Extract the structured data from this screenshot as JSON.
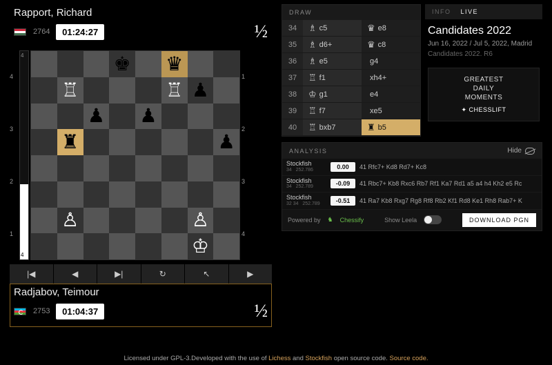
{
  "topPlayer": {
    "name": "Rapport, Richard",
    "rating": "2764",
    "clock": "01:24:27",
    "score": "½",
    "flag": "hun"
  },
  "bottomPlayer": {
    "name": "Radjabov, Teimour",
    "rating": "2753",
    "clock": "01:04:37",
    "score": "½",
    "flag": "aze"
  },
  "board": {
    "ranks_left": [
      "4",
      "3",
      "2",
      "1"
    ],
    "ranks_right": [
      "1",
      "2",
      "3",
      "4"
    ],
    "eval_top": "4",
    "eval_bottom": "4",
    "eval_white_pct": 36,
    "position": [
      [
        "",
        "",
        "",
        "bk",
        "",
        "bq",
        "",
        ""
      ],
      [
        "",
        "wr",
        "",
        "",
        "",
        "wr",
        "bp",
        ""
      ],
      [
        "",
        "",
        "bp",
        "",
        "bp",
        "",
        "",
        ""
      ],
      [
        "",
        "br",
        "",
        "",
        "",
        "",
        "",
        "bp"
      ],
      [
        "",
        "",
        "",
        "",
        "",
        "",
        "",
        ""
      ],
      [
        "",
        "",
        "",
        "",
        "",
        "",
        "",
        ""
      ],
      [
        "",
        "wp",
        "",
        "",
        "",
        "",
        "wp",
        ""
      ],
      [
        "",
        "",
        "",
        "",
        "",
        "",
        "wk",
        ""
      ]
    ],
    "hl": [
      [
        0,
        5
      ],
      [
        3,
        1
      ]
    ]
  },
  "controls": {
    "first": "|◀",
    "prev": "◀",
    "next": "▶|",
    "refresh": "↻",
    "cursor": "↖",
    "play": "▶"
  },
  "drawLabel": "DRAW",
  "tabs": {
    "info": "INFO",
    "live": "LIVE"
  },
  "event": {
    "title": "Candidates 2022",
    "dates": "Jun 16, 2022 / Jul 5, 2022, Madrid",
    "round": "Candidates 2022. R6"
  },
  "promo": {
    "line1": "GREATEST",
    "line2": "DAILY",
    "line3": "MOMENTS",
    "brand": "✦ CHESSLIFT"
  },
  "moves": [
    {
      "n": "34",
      "wp": "♗",
      "w": "c5",
      "bp": "♛",
      "b": "e8"
    },
    {
      "n": "35",
      "wp": "♗",
      "w": "d6+",
      "bp": "♛",
      "b": "c8"
    },
    {
      "n": "36",
      "wp": "♗",
      "w": "e5",
      "bp": "",
      "b": "g4"
    },
    {
      "n": "37",
      "wp": "♖",
      "w": "f1",
      "bp": "",
      "b": "xh4+"
    },
    {
      "n": "38",
      "wp": "♔",
      "w": "g1",
      "bp": "",
      "b": "e4"
    },
    {
      "n": "39",
      "wp": "♖",
      "w": "f7",
      "bp": "",
      "b": "xe5"
    },
    {
      "n": "40",
      "wp": "♖",
      "w": "bxb7",
      "bp": "♜",
      "b": "b5",
      "hl": true
    }
  ],
  "analysis": {
    "label": "ANALYSIS",
    "hide": "Hide",
    "lines": [
      {
        "eng": "Stockfish",
        "depth": "34",
        "nps": "252.786",
        "eval": "0.00",
        "pv": "41  Rfc7+  Kd8  Rd7+  Kc8"
      },
      {
        "eng": "Stockfish",
        "depth": "34",
        "nps": "252.789",
        "eval": "-0.09",
        "pv": "41  Rbc7+  Kb8  Rxc6  Rb7  Rf1  Ka7  Rd1  a5  a4  h4  Kh2  e5  Rc"
      },
      {
        "eng": "Stockfish",
        "depth": "32 34",
        "nps": "252.789",
        "eval": "-0.51",
        "pv": "41  Ra7  Kb8  Rxg7  Rg8  Rf8  Rb2  Kf1  Rd8  Ke1  Rh8  Rab7+  K"
      }
    ],
    "powered": "Powered by",
    "chessify": "Chessify",
    "leela": "Show Leela",
    "download": "DOWNLOAD PGN"
  },
  "footer": {
    "a": "Licensed under GPL-3.Developed with the use of ",
    "b": "Lichess",
    "c": " and ",
    "d": "Stockfish",
    "e": " open source code. ",
    "f": "Source code."
  }
}
